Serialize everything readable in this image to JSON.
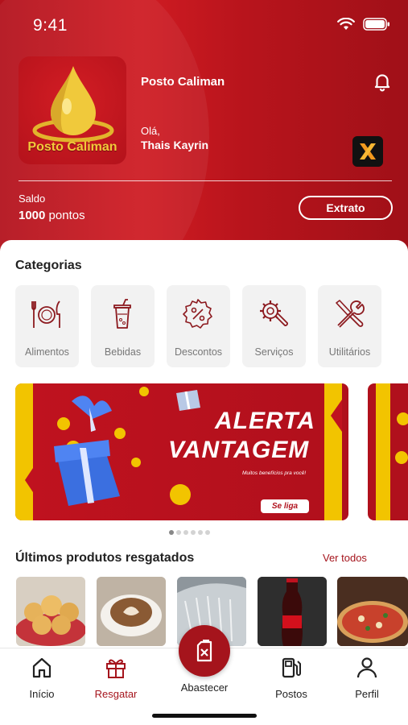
{
  "status_bar": {
    "time": "9:41"
  },
  "header": {
    "logo_text": "Posto Caliman",
    "station_name": "Posto Caliman",
    "greeting": "Olá,",
    "user_name": "Thais Kayrin",
    "balance_label": "Saldo",
    "balance_value": "1000",
    "balance_unit": "pontos",
    "statement_button": "Extrato"
  },
  "categories": {
    "title": "Categorias",
    "items": [
      {
        "label": "Alimentos",
        "icon": "cutlery-plate-icon"
      },
      {
        "label": "Bebidas",
        "icon": "drink-cup-icon"
      },
      {
        "label": "Descontos",
        "icon": "percent-badge-icon"
      },
      {
        "label": "Serviços",
        "icon": "gear-wrench-icon"
      },
      {
        "label": "Utilitários",
        "icon": "tools-icon"
      }
    ]
  },
  "banner": {
    "title_line1": "ALERTA",
    "title_line2": "VANTAGEM",
    "subtitle": "Muitos benefícios pra você!",
    "button": "Se liga",
    "slides": 6,
    "active_slide": 1
  },
  "products": {
    "title": "Últimos produtos resgatados",
    "view_all": "Ver todos",
    "items": [
      "pao-de-queijo",
      "cappuccino",
      "car-wash",
      "coca-cola",
      "pizza"
    ]
  },
  "nav": {
    "items": [
      {
        "label": "Início",
        "icon": "home-icon"
      },
      {
        "label": "Resgatar",
        "icon": "gift-icon"
      },
      {
        "label": "Abastecer",
        "icon": "fuel-can-icon"
      },
      {
        "label": "Postos",
        "icon": "fuel-pump-icon"
      },
      {
        "label": "Perfil",
        "icon": "user-icon"
      }
    ],
    "active": "Resgatar"
  },
  "colors": {
    "brand_red": "#a5141c",
    "header_red": "#c4161e",
    "logo_gold": "#f2c93a"
  }
}
